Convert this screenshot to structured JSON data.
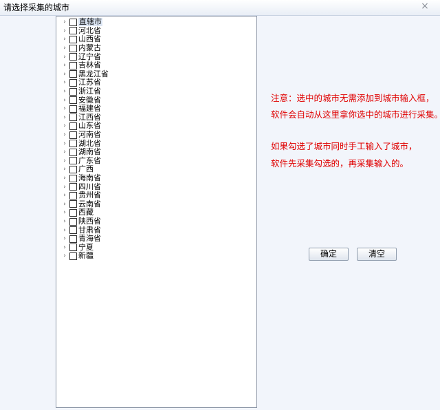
{
  "window": {
    "title": "请选择采集的城市",
    "close_glyph": "×"
  },
  "tree": {
    "expander_glyph": "›",
    "items": [
      {
        "label": "直辖市",
        "selected": true
      },
      {
        "label": "河北省"
      },
      {
        "label": "山西省"
      },
      {
        "label": "内蒙古"
      },
      {
        "label": "辽宁省"
      },
      {
        "label": "吉林省"
      },
      {
        "label": "黑龙江省"
      },
      {
        "label": "江苏省"
      },
      {
        "label": "浙江省"
      },
      {
        "label": "安徽省"
      },
      {
        "label": "福建省"
      },
      {
        "label": "江西省"
      },
      {
        "label": "山东省"
      },
      {
        "label": "河南省"
      },
      {
        "label": "湖北省"
      },
      {
        "label": "湖南省"
      },
      {
        "label": "广东省"
      },
      {
        "label": "广西"
      },
      {
        "label": "海南省"
      },
      {
        "label": "四川省"
      },
      {
        "label": "贵州省"
      },
      {
        "label": "云南省"
      },
      {
        "label": "西藏"
      },
      {
        "label": "陕西省"
      },
      {
        "label": "甘肃省"
      },
      {
        "label": "青海省"
      },
      {
        "label": "宁夏"
      },
      {
        "label": "新疆"
      }
    ]
  },
  "notice": {
    "line1": "注意：选中的城市无需添加到城市输入框，",
    "line2": "软件会自动从这里拿你选中的城市进行采集。",
    "line3": "如果勾选了城市同时手工输入了城市，",
    "line4": "软件先采集勾选的，再采集输入的。",
    "color": "#e00000"
  },
  "buttons": {
    "confirm_label": "确定",
    "clear_label": "清空"
  }
}
